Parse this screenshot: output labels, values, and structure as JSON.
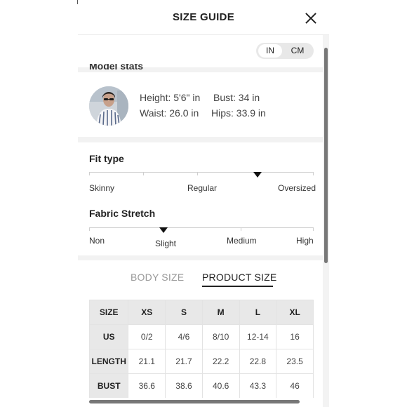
{
  "header": {
    "title": "SIZE GUIDE"
  },
  "units": {
    "in": "IN",
    "cm": "CM",
    "selected": "IN"
  },
  "model": {
    "section_label": "Model stats",
    "height": "Height: 5'6\" in",
    "bust": "Bust: 34 in",
    "waist": "Waist: 26.0 in",
    "hips": "Hips: 33.9 in"
  },
  "fit_type": {
    "label": "Fit type",
    "options": [
      "Skinny",
      "Regular",
      "Oversized"
    ],
    "position": 0.75
  },
  "fabric_stretch": {
    "label": "Fabric Stretch",
    "options": [
      "Non",
      "Slight",
      "Medium",
      "High"
    ],
    "position": 0.33
  },
  "tabs": {
    "body": "BODY SIZE",
    "product": "PRODUCT SIZE",
    "active": "product"
  },
  "table": {
    "header": [
      "SIZE",
      "XS",
      "S",
      "M",
      "L",
      "XL"
    ],
    "rows": [
      {
        "label": "US",
        "cells": [
          "0/2",
          "4/6",
          "8/10",
          "12-14",
          "16"
        ]
      },
      {
        "label": "LENGTH",
        "cells": [
          "21.1",
          "21.7",
          "22.2",
          "22.8",
          "23.5"
        ]
      },
      {
        "label": "BUST",
        "cells": [
          "36.6",
          "38.6",
          "40.6",
          "43.3",
          "46"
        ]
      }
    ]
  },
  "colors": {
    "accent": "#222222",
    "muted": "#999999",
    "band": "#f2f2f2",
    "table_header": "#e8e8e8"
  }
}
